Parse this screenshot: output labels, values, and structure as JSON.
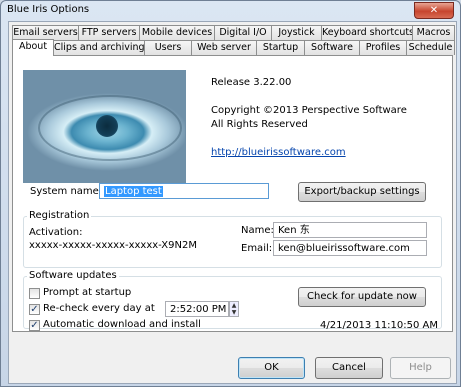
{
  "window": {
    "title": "Blue Iris Options",
    "close_icon": "x-icon"
  },
  "tabs_row1": [
    "Email servers",
    "FTP servers",
    "Mobile devices",
    "Digital I/O",
    "Joystick",
    "Keyboard shortcuts",
    "Macros"
  ],
  "tabs_row2": [
    "About",
    "Clips and archiving",
    "Users",
    "Web server",
    "Startup",
    "Software",
    "Profiles",
    "Schedule"
  ],
  "active_tab": "About",
  "about": {
    "release": "Release 3.22.00",
    "copyright": "Copyright ©2013 Perspective Software",
    "rights": "All Rights Reserved",
    "link": "http://blueirissoftware.com",
    "system_name_label": "System name:",
    "system_name_value": "Laptop test",
    "export_button": "Export/backup settings"
  },
  "registration": {
    "title": "Registration",
    "activation_label": "Activation:",
    "activation_value": "xxxxx-xxxxx-xxxxx-xxxxx-X9N2M",
    "name_label": "Name:",
    "name_value": "Ken 东",
    "email_label": "Email:",
    "email_value": "ken@blueirissoftware.com"
  },
  "updates": {
    "title": "Software updates",
    "prompt_label": "Prompt at startup",
    "prompt_checked": false,
    "recheck_label": "Re-check every day at",
    "recheck_checked": true,
    "time_value": "2:52:00 PM",
    "auto_label": "Automatic download and install",
    "auto_checked": true,
    "check_button": "Check for update now",
    "last_check": "4/21/2013 11:10:50 AM"
  },
  "buttons": {
    "ok": "OK",
    "cancel": "Cancel",
    "help": "Help"
  }
}
